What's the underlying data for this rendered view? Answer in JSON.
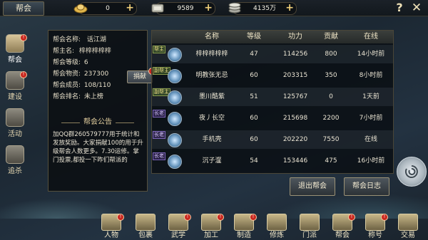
{
  "topbar": {
    "title": "帮会",
    "ingot": {
      "value": "0",
      "icon": "gold-ingot-icon"
    },
    "silver": {
      "value": "9589",
      "icon": "silver-icon"
    },
    "coins": {
      "value": "4135万",
      "icon": "coin-stack-icon"
    },
    "help": "?",
    "close": "✕"
  },
  "sidenav": [
    {
      "label": "帮会",
      "icon": "guild-banner-icon",
      "active": true,
      "badge": true
    },
    {
      "label": "建设",
      "icon": "build-icon",
      "active": false,
      "badge": true
    },
    {
      "label": "活动",
      "icon": "activity-icon",
      "active": false,
      "badge": false
    },
    {
      "label": "追杀",
      "icon": "pursue-icon",
      "active": false,
      "badge": false
    }
  ],
  "info": {
    "name_key": "帮会名称:",
    "name_val": "话江湖",
    "leader_key": "帮主名:",
    "leader_val": "梓梓梓梓梓",
    "level_key": "帮会等级:",
    "level_val": "6",
    "supply_key": "帮会物资:",
    "supply_val": "237300",
    "members_key": "帮会成员:",
    "members_val": "108/110",
    "rank_key": "帮会排名:",
    "rank_val": "未上榜",
    "donate": "捐献",
    "notice_title": "帮会公告",
    "notice": "加QQ群260579777用于统计和发放奖励。大家捐献100的用于升级帮会人数更多。7.30运修。掌门投票,都投一下昨们帮派的"
  },
  "table": {
    "headers": [
      "名称",
      "等级",
      "功力",
      "贡献",
      "在线"
    ],
    "rows": [
      {
        "tag": "帮主",
        "tag_type": "leader",
        "name": "梓梓梓梓梓",
        "level": "47",
        "power": "114256",
        "contrib": "800",
        "online": "14小时前"
      },
      {
        "tag": "副帮主",
        "tag_type": "leader",
        "name": "明教张无忌",
        "level": "60",
        "power": "203315",
        "contrib": "350",
        "online": "8小时前"
      },
      {
        "tag": "副帮主",
        "tag_type": "leader",
        "name": "墨川酷紫",
        "level": "51",
        "power": "125767",
        "contrib": "0",
        "online": "1天前"
      },
      {
        "tag": "长老",
        "tag_type": "elder",
        "name": "夜丿长空",
        "level": "60",
        "power": "215698",
        "contrib": "2200",
        "online": "7小时前"
      },
      {
        "tag": "长老",
        "tag_type": "elder",
        "name": "手机壳",
        "level": "60",
        "power": "202220",
        "contrib": "7550",
        "online": "在线"
      },
      {
        "tag": "长老",
        "tag_type": "elder",
        "name": "沉子瀣",
        "level": "54",
        "power": "153446",
        "contrib": "475",
        "online": "16小时前"
      }
    ]
  },
  "buttons": {
    "leave": "退出帮会",
    "log": "帮会日志"
  },
  "bottom": [
    {
      "label": "人物",
      "icon": "character-icon",
      "badge": true
    },
    {
      "label": "包裹",
      "icon": "bag-icon",
      "badge": false
    },
    {
      "label": "武学",
      "icon": "martial-arts-icon",
      "badge": true
    },
    {
      "label": "加工",
      "icon": "craft-icon",
      "badge": true
    },
    {
      "label": "制造",
      "icon": "forge-icon",
      "badge": true
    },
    {
      "label": "修炼",
      "icon": "cultivate-icon",
      "badge": false
    },
    {
      "label": "门派",
      "icon": "sect-gate-icon",
      "badge": false
    },
    {
      "label": "帮会",
      "icon": "guild-icon",
      "badge": true
    },
    {
      "label": "称号",
      "icon": "title-icon",
      "badge": true
    },
    {
      "label": "交易",
      "icon": "trade-icon",
      "badge": false
    }
  ]
}
